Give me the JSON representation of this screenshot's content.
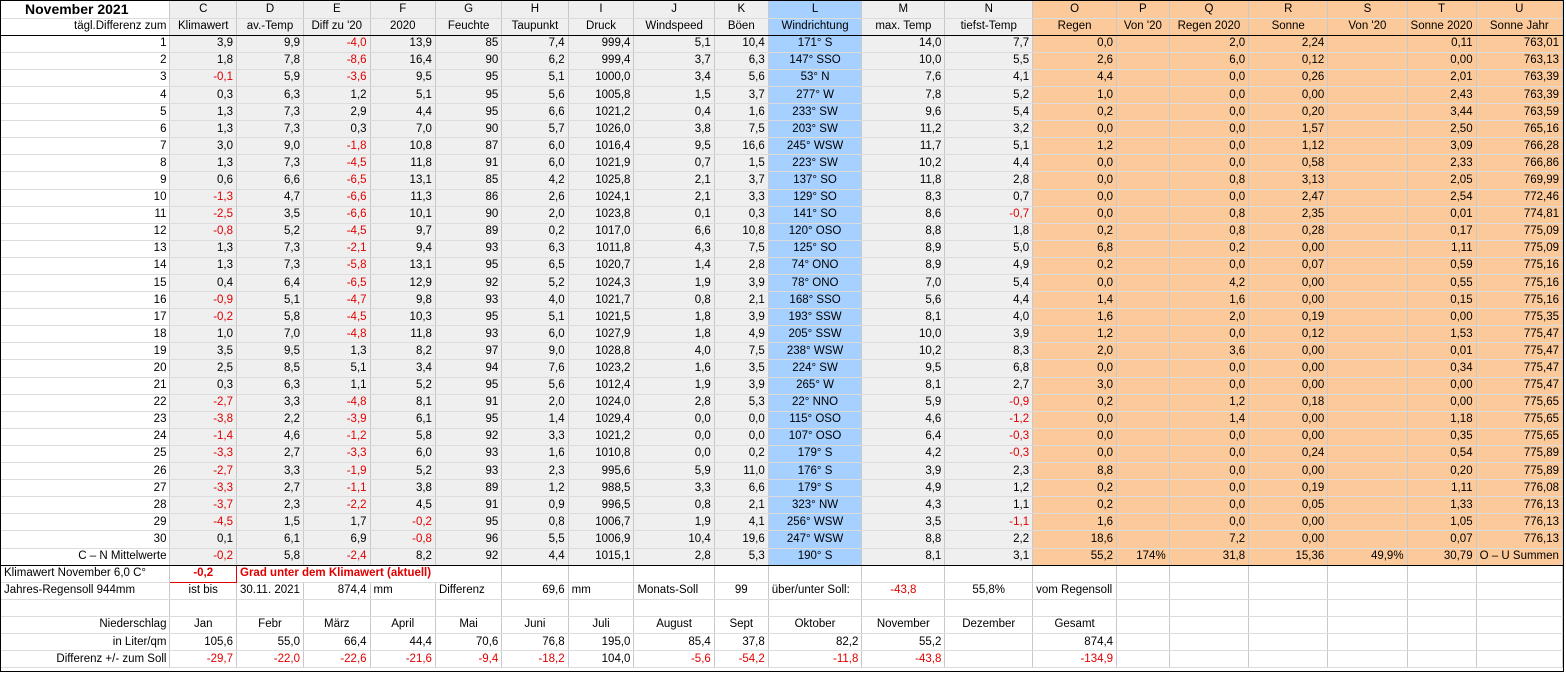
{
  "title": "November 2021",
  "letters": [
    "C",
    "D",
    "E",
    "F",
    "G",
    "H",
    "I",
    "J",
    "K",
    "L",
    "M",
    "N",
    "O",
    "P",
    "Q",
    "R",
    "S",
    "T",
    "U"
  ],
  "header_first": "tägl.Differenz zum",
  "headers": [
    "Klimawert",
    "av.-Temp",
    "Diff zu '20",
    "2020",
    "Feuchte",
    "Taupunkt",
    "Druck",
    "Windspeed",
    "Böen",
    "Windrichtung",
    "max. Temp",
    "tiefst-Temp",
    "Regen",
    "Von '20",
    "Regen 2020",
    "Sonne",
    "Von '20",
    "Sonne 2020",
    "Sonne Jahr"
  ],
  "days": [
    [
      "1",
      "3,9",
      "9,9",
      "-4,0",
      "13,9",
      "85",
      "7,4",
      "999,4",
      "5,1",
      "10,4",
      "171° S",
      "14,0",
      "7,7",
      "0,0",
      "",
      "2,0",
      "2,24",
      "",
      "0,11",
      "763,01"
    ],
    [
      "2",
      "1,8",
      "7,8",
      "-8,6",
      "16,4",
      "90",
      "6,2",
      "999,4",
      "3,7",
      "6,3",
      "147° SSO",
      "10,0",
      "5,5",
      "2,6",
      "",
      "6,0",
      "0,12",
      "",
      "0,00",
      "763,13"
    ],
    [
      "3",
      "-0,1",
      "5,9",
      "-3,6",
      "9,5",
      "95",
      "5,1",
      "1000,0",
      "3,4",
      "5,6",
      "53° N",
      "7,6",
      "4,1",
      "4,4",
      "",
      "0,0",
      "0,26",
      "",
      "2,01",
      "763,39"
    ],
    [
      "4",
      "0,3",
      "6,3",
      "1,2",
      "5,1",
      "95",
      "5,6",
      "1005,8",
      "1,5",
      "3,7",
      "277° W",
      "7,8",
      "5,2",
      "1,0",
      "",
      "0,0",
      "0,00",
      "",
      "2,43",
      "763,39"
    ],
    [
      "5",
      "1,3",
      "7,3",
      "2,9",
      "4,4",
      "95",
      "6,6",
      "1021,2",
      "0,4",
      "1,6",
      "233° SW",
      "9,6",
      "5,4",
      "0,2",
      "",
      "0,0",
      "0,20",
      "",
      "3,44",
      "763,59"
    ],
    [
      "6",
      "1,3",
      "7,3",
      "0,3",
      "7,0",
      "90",
      "5,7",
      "1026,0",
      "3,8",
      "7,5",
      "203° SW",
      "11,2",
      "3,2",
      "0,0",
      "",
      "0,0",
      "1,57",
      "",
      "2,50",
      "765,16"
    ],
    [
      "7",
      "3,0",
      "9,0",
      "-1,8",
      "10,8",
      "87",
      "6,0",
      "1016,4",
      "9,5",
      "16,6",
      "245° WSW",
      "11,7",
      "5,1",
      "1,2",
      "",
      "0,0",
      "1,12",
      "",
      "3,09",
      "766,28"
    ],
    [
      "8",
      "1,3",
      "7,3",
      "-4,5",
      "11,8",
      "91",
      "6,0",
      "1021,9",
      "0,7",
      "1,5",
      "223° SW",
      "10,2",
      "4,4",
      "0,0",
      "",
      "0,0",
      "0,58",
      "",
      "2,33",
      "766,86"
    ],
    [
      "9",
      "0,6",
      "6,6",
      "-6,5",
      "13,1",
      "85",
      "4,2",
      "1025,8",
      "2,1",
      "3,7",
      "137° SO",
      "11,8",
      "2,8",
      "0,0",
      "",
      "0,8",
      "3,13",
      "",
      "2,05",
      "769,99"
    ],
    [
      "10",
      "-1,3",
      "4,7",
      "-6,6",
      "11,3",
      "86",
      "2,6",
      "1024,1",
      "2,1",
      "3,3",
      "129° SO",
      "8,3",
      "0,7",
      "0,0",
      "",
      "0,0",
      "2,47",
      "",
      "2,54",
      "772,46"
    ],
    [
      "11",
      "-2,5",
      "3,5",
      "-6,6",
      "10,1",
      "90",
      "2,0",
      "1023,8",
      "0,1",
      "0,3",
      "141° SO",
      "8,6",
      "-0,7",
      "0,0",
      "",
      "0,8",
      "2,35",
      "",
      "0,01",
      "774,81"
    ],
    [
      "12",
      "-0,8",
      "5,2",
      "-4,5",
      "9,7",
      "89",
      "0,2",
      "1017,0",
      "6,6",
      "10,8",
      "120° OSO",
      "8,8",
      "1,8",
      "0,2",
      "",
      "0,8",
      "0,28",
      "",
      "0,17",
      "775,09"
    ],
    [
      "13",
      "1,3",
      "7,3",
      "-2,1",
      "9,4",
      "93",
      "6,3",
      "1011,8",
      "4,3",
      "7,5",
      "125° SO",
      "8,9",
      "5,0",
      "6,8",
      "",
      "0,2",
      "0,00",
      "",
      "1,11",
      "775,09"
    ],
    [
      "14",
      "1,3",
      "7,3",
      "-5,8",
      "13,1",
      "95",
      "6,5",
      "1020,7",
      "1,4",
      "2,8",
      "74° ONO",
      "8,9",
      "4,9",
      "0,2",
      "",
      "0,0",
      "0,07",
      "",
      "0,59",
      "775,16"
    ],
    [
      "15",
      "0,4",
      "6,4",
      "-6,5",
      "12,9",
      "92",
      "5,2",
      "1024,3",
      "1,9",
      "3,9",
      "78° ONO",
      "7,0",
      "5,4",
      "0,0",
      "",
      "4,2",
      "0,00",
      "",
      "0,55",
      "775,16"
    ],
    [
      "16",
      "-0,9",
      "5,1",
      "-4,7",
      "9,8",
      "93",
      "4,0",
      "1021,7",
      "0,8",
      "2,1",
      "168° SSO",
      "5,6",
      "4,4",
      "1,4",
      "",
      "1,6",
      "0,00",
      "",
      "0,15",
      "775,16"
    ],
    [
      "17",
      "-0,2",
      "5,8",
      "-4,5",
      "10,3",
      "95",
      "5,1",
      "1021,5",
      "1,8",
      "3,9",
      "193° SSW",
      "8,1",
      "4,0",
      "1,6",
      "",
      "2,0",
      "0,19",
      "",
      "0,00",
      "775,35"
    ],
    [
      "18",
      "1,0",
      "7,0",
      "-4,8",
      "11,8",
      "93",
      "6,0",
      "1027,9",
      "1,8",
      "4,9",
      "205° SSW",
      "10,0",
      "3,9",
      "1,2",
      "",
      "0,0",
      "0,12",
      "",
      "1,53",
      "775,47"
    ],
    [
      "19",
      "3,5",
      "9,5",
      "1,3",
      "8,2",
      "97",
      "9,0",
      "1028,8",
      "4,0",
      "7,5",
      "238° WSW",
      "10,2",
      "8,3",
      "2,0",
      "",
      "3,6",
      "0,00",
      "",
      "0,01",
      "775,47"
    ],
    [
      "20",
      "2,5",
      "8,5",
      "5,1",
      "3,4",
      "94",
      "7,6",
      "1023,2",
      "1,6",
      "3,5",
      "224° SW",
      "9,5",
      "6,8",
      "0,0",
      "",
      "0,0",
      "0,00",
      "",
      "0,34",
      "775,47"
    ],
    [
      "21",
      "0,3",
      "6,3",
      "1,1",
      "5,2",
      "95",
      "5,6",
      "1012,4",
      "1,9",
      "3,9",
      "265° W",
      "8,1",
      "2,7",
      "3,0",
      "",
      "0,0",
      "0,00",
      "",
      "0,00",
      "775,47"
    ],
    [
      "22",
      "-2,7",
      "3,3",
      "-4,8",
      "8,1",
      "91",
      "2,0",
      "1024,0",
      "2,8",
      "5,3",
      "22° NNO",
      "5,9",
      "-0,9",
      "0,2",
      "",
      "1,2",
      "0,18",
      "",
      "0,00",
      "775,65"
    ],
    [
      "23",
      "-3,8",
      "2,2",
      "-3,9",
      "6,1",
      "95",
      "1,4",
      "1029,4",
      "0,0",
      "0,0",
      "115° OSO",
      "4,6",
      "-1,2",
      "0,0",
      "",
      "1,4",
      "0,00",
      "",
      "1,18",
      "775,65"
    ],
    [
      "24",
      "-1,4",
      "4,6",
      "-1,2",
      "5,8",
      "92",
      "3,3",
      "1021,2",
      "0,0",
      "0,0",
      "107° OSO",
      "6,4",
      "-0,3",
      "0,0",
      "",
      "0,0",
      "0,00",
      "",
      "0,35",
      "775,65"
    ],
    [
      "25",
      "-3,3",
      "2,7",
      "-3,3",
      "6,0",
      "93",
      "1,6",
      "1010,8",
      "0,0",
      "0,2",
      "179° S",
      "4,2",
      "-0,3",
      "0,0",
      "",
      "0,0",
      "0,24",
      "",
      "0,54",
      "775,89"
    ],
    [
      "26",
      "-2,7",
      "3,3",
      "-1,9",
      "5,2",
      "93",
      "2,3",
      "995,6",
      "5,9",
      "11,0",
      "176° S",
      "3,9",
      "2,3",
      "8,8",
      "",
      "0,0",
      "0,00",
      "",
      "0,20",
      "775,89"
    ],
    [
      "27",
      "-3,3",
      "2,7",
      "-1,1",
      "3,8",
      "89",
      "1,2",
      "988,5",
      "3,3",
      "6,6",
      "179° S",
      "4,9",
      "1,2",
      "0,2",
      "",
      "0,0",
      "0,19",
      "",
      "1,11",
      "776,08"
    ],
    [
      "28",
      "-3,7",
      "2,3",
      "-2,2",
      "4,5",
      "91",
      "0,9",
      "996,5",
      "0,8",
      "2,1",
      "323° NW",
      "4,3",
      "1,1",
      "0,2",
      "",
      "0,0",
      "0,05",
      "",
      "1,33",
      "776,13"
    ],
    [
      "29",
      "-4,5",
      "1,5",
      "1,7",
      "-0,2",
      "95",
      "0,8",
      "1006,7",
      "1,9",
      "4,1",
      "256° WSW",
      "3,5",
      "-1,1",
      "1,6",
      "",
      "0,0",
      "0,00",
      "",
      "1,05",
      "776,13"
    ],
    [
      "30",
      "0,1",
      "6,1",
      "6,9",
      "-0,8",
      "96",
      "5,5",
      "1006,9",
      "10,4",
      "19,6",
      "247° WSW",
      "8,8",
      "2,2",
      "18,6",
      "",
      "7,2",
      "0,00",
      "",
      "0,07",
      "776,13"
    ]
  ],
  "summary": [
    "C – N Mittelwerte",
    "-0,2",
    "5,8",
    "-2,4",
    "8,2",
    "92",
    "4,4",
    "1015,1",
    "2,8",
    "5,3",
    "190° S",
    "8,1",
    "3,1",
    "55,2",
    "174%",
    "31,8",
    "15,36",
    "49,9%",
    "30,79",
    "O – U Summen"
  ],
  "klima": {
    "label": "Klimawert November 6,0 C°",
    "value": "-0,2",
    "text": "Grad unter dem Klimawert (aktuell)"
  },
  "regen_row": {
    "label": "Jahres-Regensoll 944mm",
    "istbis": "ist bis",
    "date": "30.11. 2021",
    "value": "874,4",
    "unit": "mm",
    "diff_label": "Differenz",
    "diff_value": "69,6",
    "diff_unit": "mm",
    "soll_label": "Monats-Soll",
    "soll_value": "99",
    "uber_label": "über/unter Soll:",
    "uber_value": "-43,8",
    "pct": "55,8%",
    "vom": "vom Regensoll"
  },
  "monthly": {
    "header_label": "Niederschlag",
    "months": [
      "Jan",
      "Febr",
      "März",
      "April",
      "Mai",
      "Juni",
      "Juli",
      "August",
      "Sept",
      "Oktober",
      "November",
      "Dezember",
      "Gesamt"
    ],
    "liter_label": "in Liter/qm",
    "liter": [
      "105,6",
      "55,0",
      "66,4",
      "44,4",
      "70,6",
      "76,8",
      "195,0",
      "85,4",
      "37,8",
      "82,2",
      "55,2",
      "",
      "874,4"
    ],
    "diff_label": "Differenz  +/- zum Soll",
    "diff": [
      "-29,7",
      "-22,0",
      "-22,6",
      "-21,6",
      "-9,4",
      "-18,2",
      "104,0",
      "-5,6",
      "-54,2",
      "-11,8",
      "-43,8",
      "",
      "-134,9"
    ]
  }
}
